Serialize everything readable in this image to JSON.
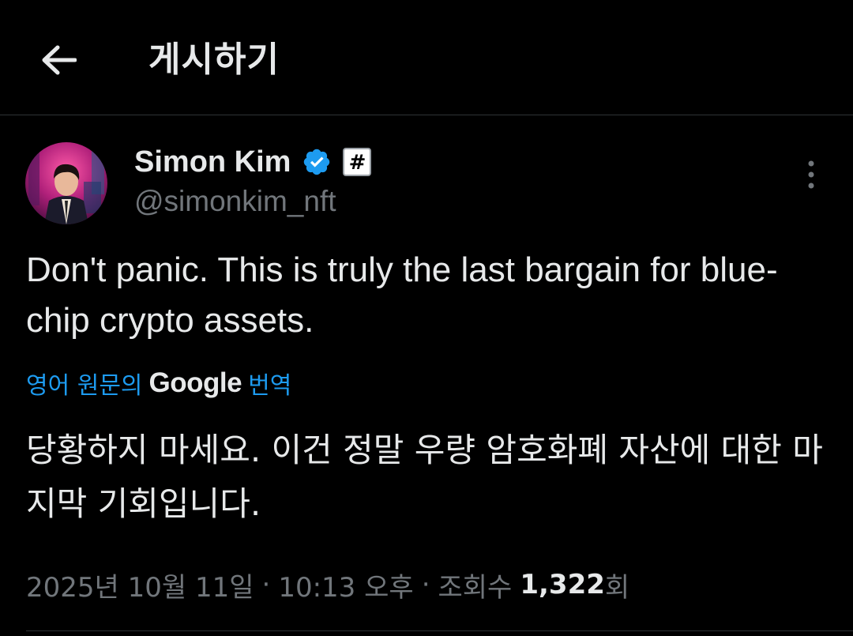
{
  "header": {
    "back_icon": "arrow-left-icon",
    "title": "게시하기"
  },
  "author": {
    "display_name": "Simon Kim",
    "verified_icon": "verified-badge-icon",
    "affiliation_badge": "#",
    "handle": "@simonkim_nft",
    "more_icon": "more-vertical-icon"
  },
  "tweet": {
    "text": "Don't panic. This is truly the last bargain for blue-chip crypto assets.",
    "translation": {
      "source_label": "영어 원문의",
      "provider": "Google",
      "action_label": "번역",
      "text": "당황하지 마세요. 이건 정말 우량 암호화폐 자산에 대한 마지막 기회입니다."
    }
  },
  "meta": {
    "date": "2025년 10월 11일",
    "separator": "·",
    "time": "10:13 오후",
    "views_label": "조회수",
    "views_count": "1,322",
    "views_suffix": "회"
  },
  "colors": {
    "background": "#000000",
    "text_primary": "#e7e9ea",
    "text_secondary": "#71767b",
    "accent": "#1d9bf0",
    "divider": "#2f3336"
  }
}
